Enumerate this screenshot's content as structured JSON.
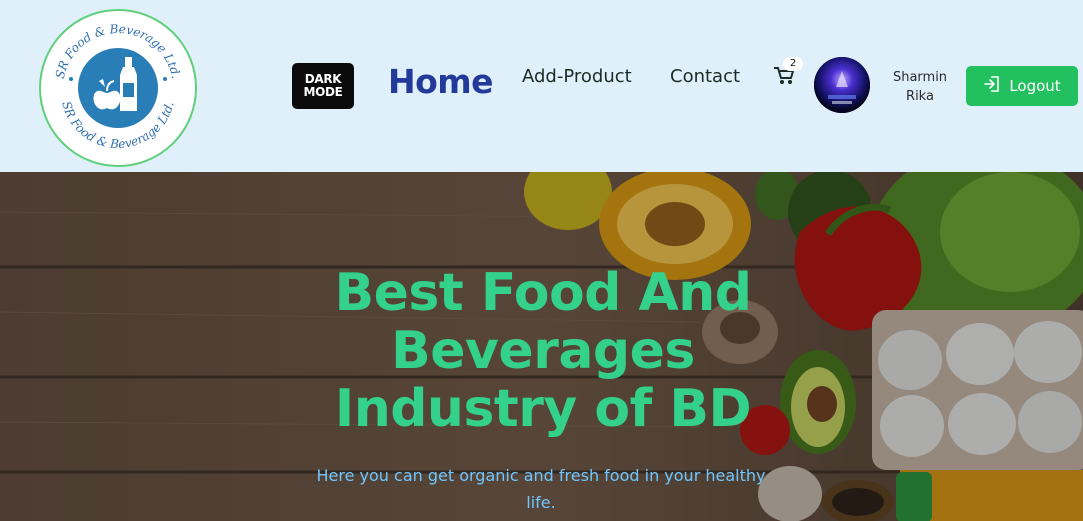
{
  "brand": {
    "logo_text": "SR Food & Beverage Ltd.",
    "accent_color": "#22c05e"
  },
  "nav": {
    "dark_mode_line1": "DARK",
    "dark_mode_line2": "MODE",
    "home_label": "Home",
    "add_product_label": "Add-Product",
    "contact_label": "Contact",
    "cart_count": "2",
    "cart_icon": "cart-icon"
  },
  "user": {
    "first_name": "Sharmin",
    "last_name": "Rika",
    "logout_label": "Logout",
    "logout_icon": "logout-icon"
  },
  "hero": {
    "title": "Best Food And Beverages Industry of BD",
    "subtitle": "Here you can get organic and fresh food in your healthy life.",
    "title_color": "#34d18c",
    "subtitle_color": "#6fc7ff"
  }
}
